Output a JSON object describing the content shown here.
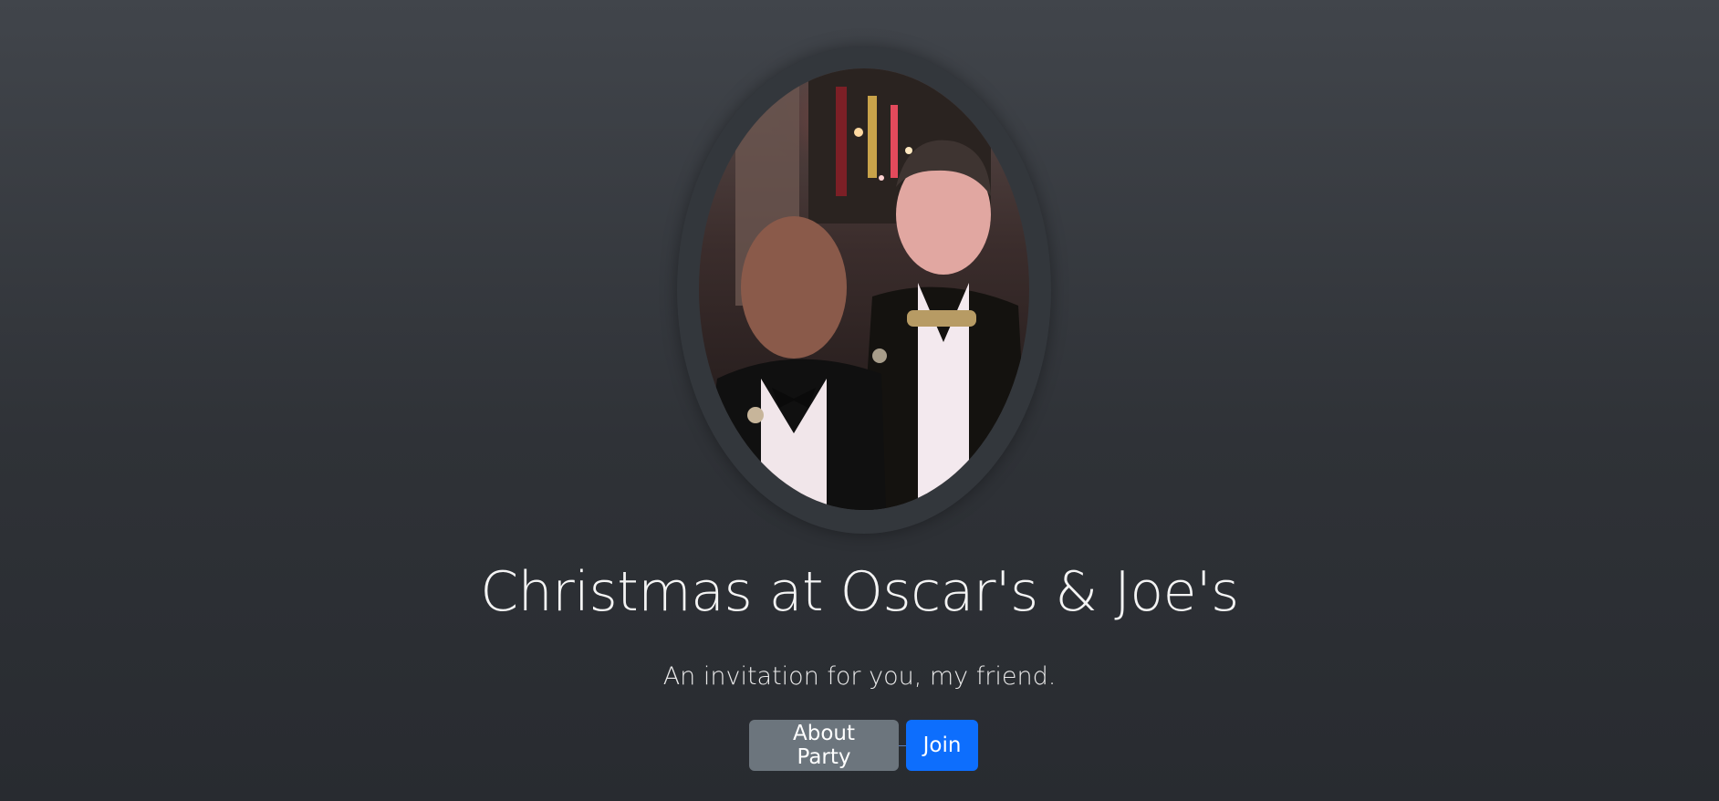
{
  "hero": {
    "photo_alt": "Oscar and Joe",
    "title": "Christmas at Oscar's & Joe's",
    "lead": "An invitation for you, my friend."
  },
  "actions": {
    "about_label": "About Party",
    "join_label": "Join"
  },
  "colors": {
    "background_top": "#41454b",
    "background_bottom": "#282b30",
    "secondary_button": "#6c757d",
    "primary_button": "#0d6efd"
  }
}
